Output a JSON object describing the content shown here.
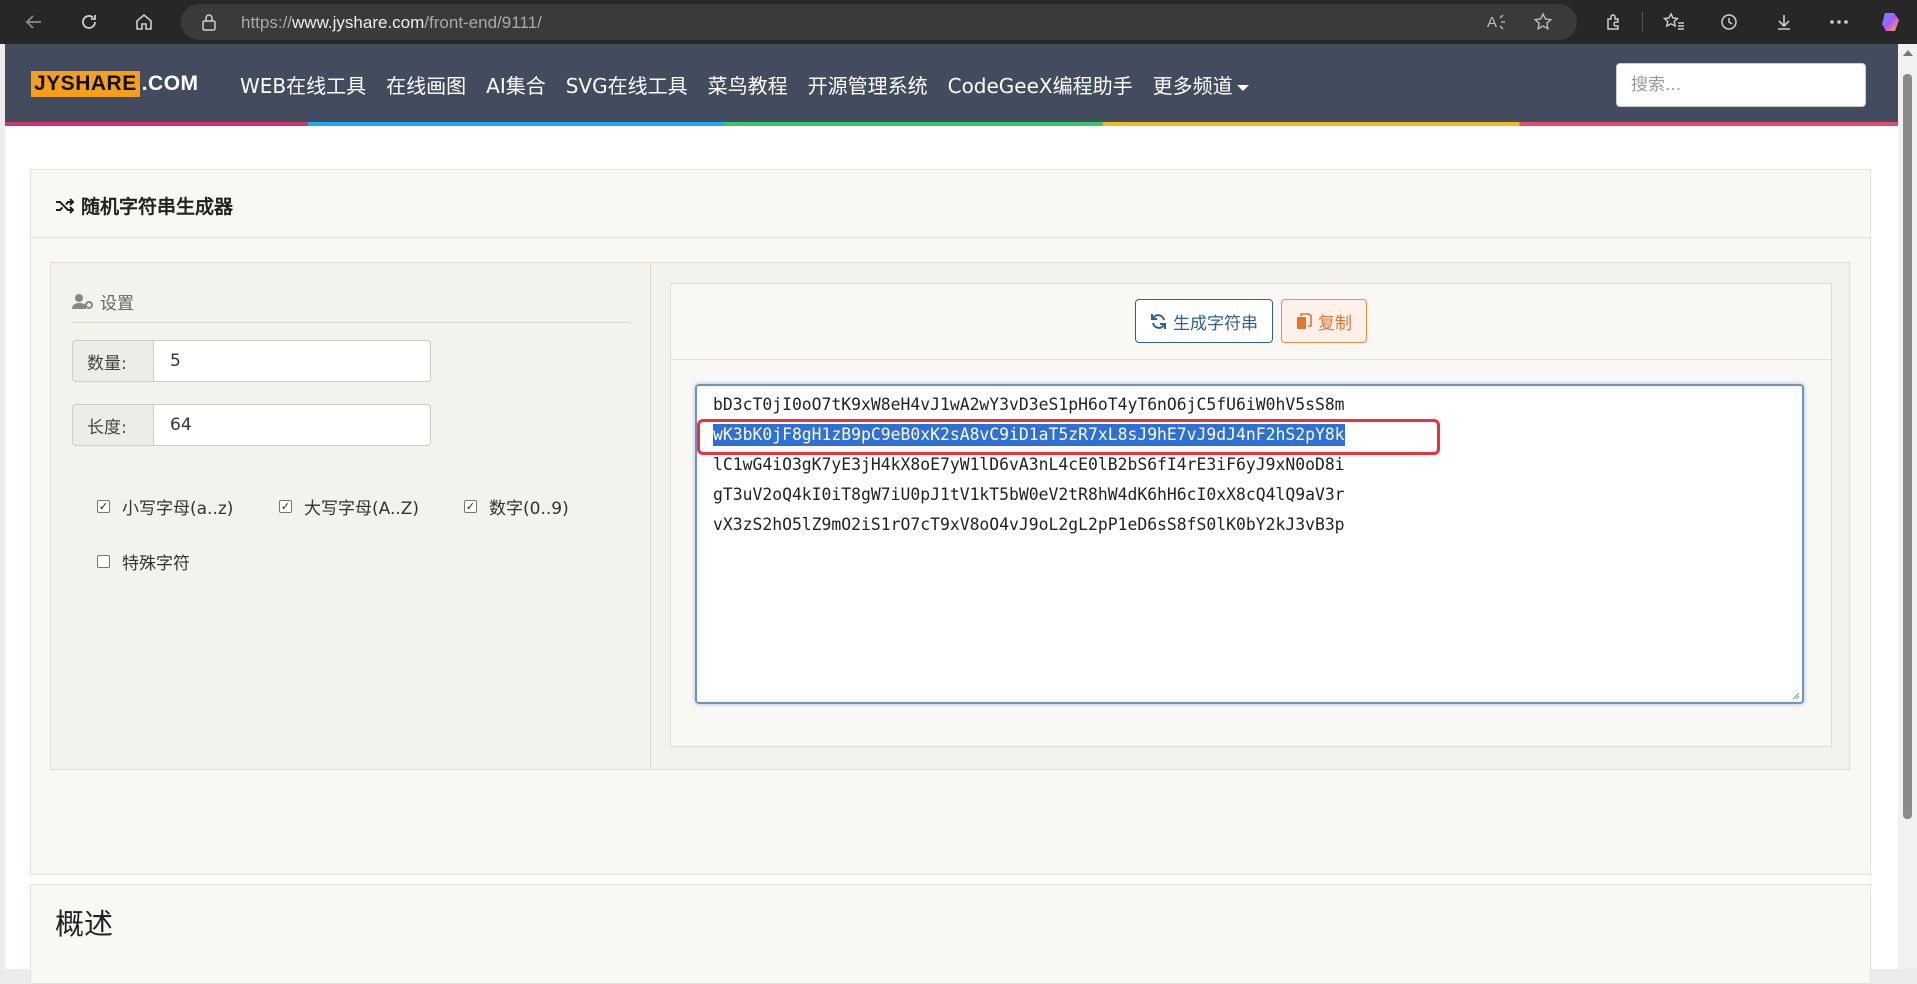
{
  "browser": {
    "url_prefix": "https://",
    "url_domain": "www.jyshare.com",
    "url_path": "/front-end/9111/"
  },
  "site": {
    "logo_part1": "JYSHARE",
    "logo_part2": ".COM",
    "nav": [
      "WEB在线工具",
      "在线画图",
      "AI集合",
      "SVG在线工具",
      "菜鸟教程",
      "开源管理系统",
      "CodeGeeX编程助手",
      "更多频道"
    ],
    "search_placeholder": "搜索..."
  },
  "tool": {
    "title": "随机字符串生成器",
    "settings_label": "设置",
    "count_label": "数量:",
    "count_value": "5",
    "length_label": "长度:",
    "length_value": "64",
    "options": [
      {
        "label": "小写字母(a..z)",
        "checked": true
      },
      {
        "label": "大写字母(A..Z)",
        "checked": true
      },
      {
        "label": "数字(0..9)",
        "checked": true
      },
      {
        "label": "特殊字符",
        "checked": false
      }
    ],
    "generate_button": "生成字符串",
    "copy_button": "复制",
    "output_lines": [
      "bD3cT0jI0oO7tK9xW8eH4vJ1wA2wY3vD3eS1pH6oT4yT6nO6jC5fU6iW0hV5sS8m",
      "wK3bK0jF8gH1zB9pC9eB0xK2sA8vC9iD1aT5zR7xL8sJ9hE7vJ9dJ4nF2hS2pY8k",
      "lC1wG4iO3gK7yE3jH4kX8oE7yW1lD6vA3nL4cE0lB2bS6fI4rE3iF6yJ9xN0oD8i",
      "gT3uV2oQ4kI0iT8gW7iU0pJ1tV1kT5bW0eV2tR8hW4dK6hH6cI0xX8cQ4lQ9aV3r",
      "vX3zS2hO5lZ9mO2iS1rO7cT9xV8oO4vJ9oL2gL2pP1eD6sS8fS0lK0bY2kJ3vB3p"
    ],
    "selected_line_index": 1
  },
  "overview": {
    "title": "概述"
  }
}
